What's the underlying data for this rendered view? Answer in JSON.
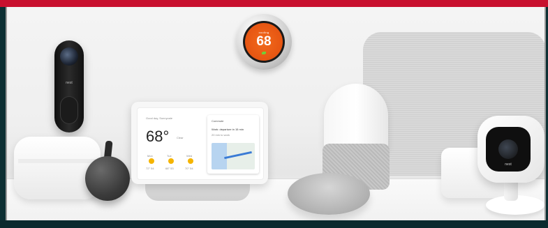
{
  "thermostat": {
    "label": "cooling",
    "temperature": "68"
  },
  "doorbell": {
    "brand": "nest"
  },
  "camera": {
    "brand": "nest"
  },
  "nest_hub": {
    "location": "Good day, Sunnyvale",
    "temperature": "68°",
    "condition": "Clear",
    "forecast": [
      {
        "day": "Mon",
        "temps": "72° 54"
      },
      {
        "day": "Tue",
        "temps": "68° 53"
      },
      {
        "day": "Wed",
        "temps": "70° 54"
      }
    ],
    "commute_title": "Commute",
    "commute_line1": "Work: departure in 15 min",
    "commute_line2": "20 min to work"
  },
  "colors": {
    "accent_red": "#c8102e",
    "thermostat_orange": "#e65512",
    "bottom_bar": "#0b2a2e"
  }
}
